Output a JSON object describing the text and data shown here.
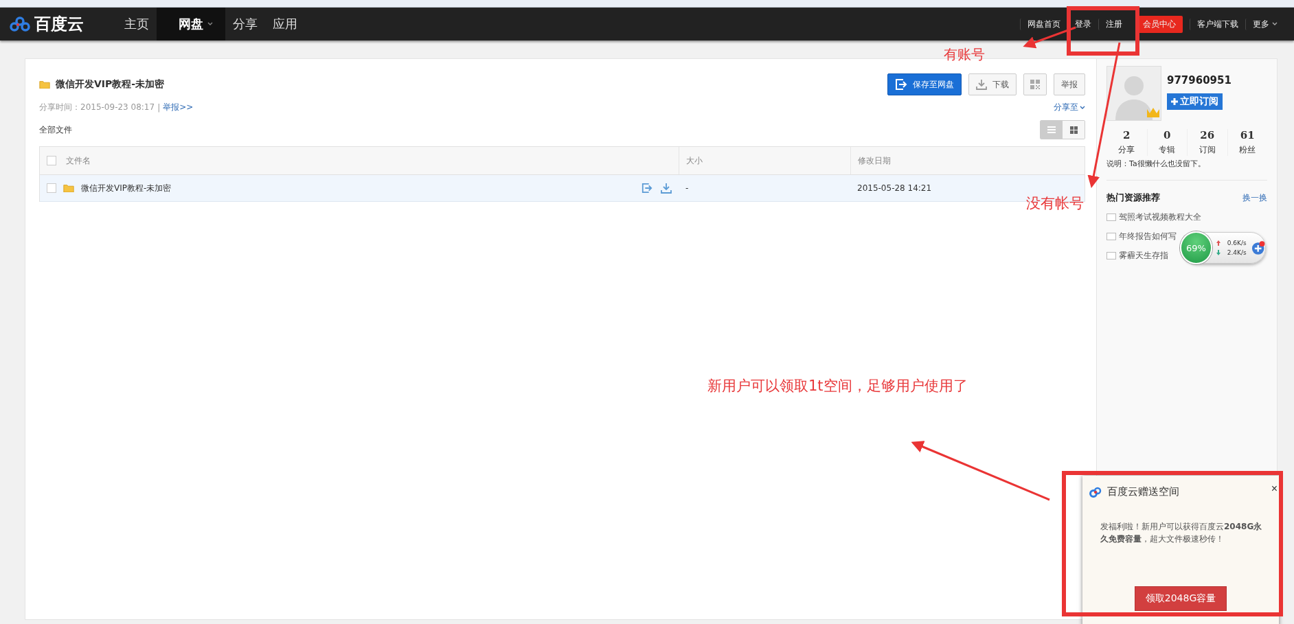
{
  "nav": {
    "logo": "百度云",
    "items": [
      {
        "label": "主页",
        "selected": false,
        "dropdown": false
      },
      {
        "label": "网盘",
        "selected": true,
        "dropdown": true
      },
      {
        "label": "分享",
        "selected": false,
        "dropdown": false
      },
      {
        "label": "应用",
        "selected": false,
        "dropdown": false
      }
    ],
    "links": [
      {
        "label": "网盘首页",
        "kind": "link"
      },
      {
        "label": "登录",
        "kind": "link"
      },
      {
        "label": "注册",
        "kind": "link"
      },
      {
        "label": "会员中心",
        "kind": "vip"
      },
      {
        "label": "客户端下载",
        "kind": "link"
      },
      {
        "label": "更多",
        "kind": "menu"
      }
    ]
  },
  "share": {
    "title": "微信开发VIP教程-未加密",
    "buttons": [
      {
        "label": "保存至网盘",
        "kind": "primary"
      },
      {
        "label": "下载",
        "kind": "download"
      },
      {
        "kind": "qr"
      },
      {
        "label": "举报",
        "kind": "plain"
      }
    ],
    "share_time": "分享时间：2015-09-23 08:17",
    "separator": "|",
    "report_link": "举报>>",
    "share_to": "分享至",
    "breadcrumb": "全部文件",
    "view_modes": [
      {
        "kind": "list",
        "selected": true
      },
      {
        "kind": "grid",
        "selected": false
      }
    ]
  },
  "table": {
    "select_all_checked": false,
    "columns": [
      "文件名",
      "大小",
      "修改日期"
    ],
    "rows": [
      {
        "name": "微信开发VIP教程-未加密",
        "size": "-",
        "modified": "2015-05-28 14:21",
        "checked": false
      }
    ]
  },
  "profile": {
    "name": "977960951",
    "subscribe": "立即订阅",
    "stats": [
      {
        "value": "2",
        "label": "分享"
      },
      {
        "value": "0",
        "label": "专辑"
      },
      {
        "value": "26",
        "label": "订阅"
      },
      {
        "value": "61",
        "label": "粉丝"
      }
    ],
    "note": "说明：Ta很懒什么也没留下。"
  },
  "hot": {
    "title": "热门资源推荐",
    "refresh": "换一换",
    "items": [
      "驾照考试视频教程大全",
      "年终报告如何写",
      "雾霾天生存指"
    ]
  },
  "speed_widget": {
    "percent": "69%",
    "up": "0.6K/s",
    "down": "2.4K/s"
  },
  "popup": {
    "title": "百度云赠送空间",
    "close": "×",
    "message": "发福利啦！新用户可以获得百度云**2048G永久免费容量**，超大文件极速秒传！",
    "button": "领取2048G容量"
  },
  "annotations": [
    {
      "text": "有账号"
    },
    {
      "text": "没有帐号"
    },
    {
      "text": "新用户可以领取1t空间，足够用户使用了"
    }
  ]
}
